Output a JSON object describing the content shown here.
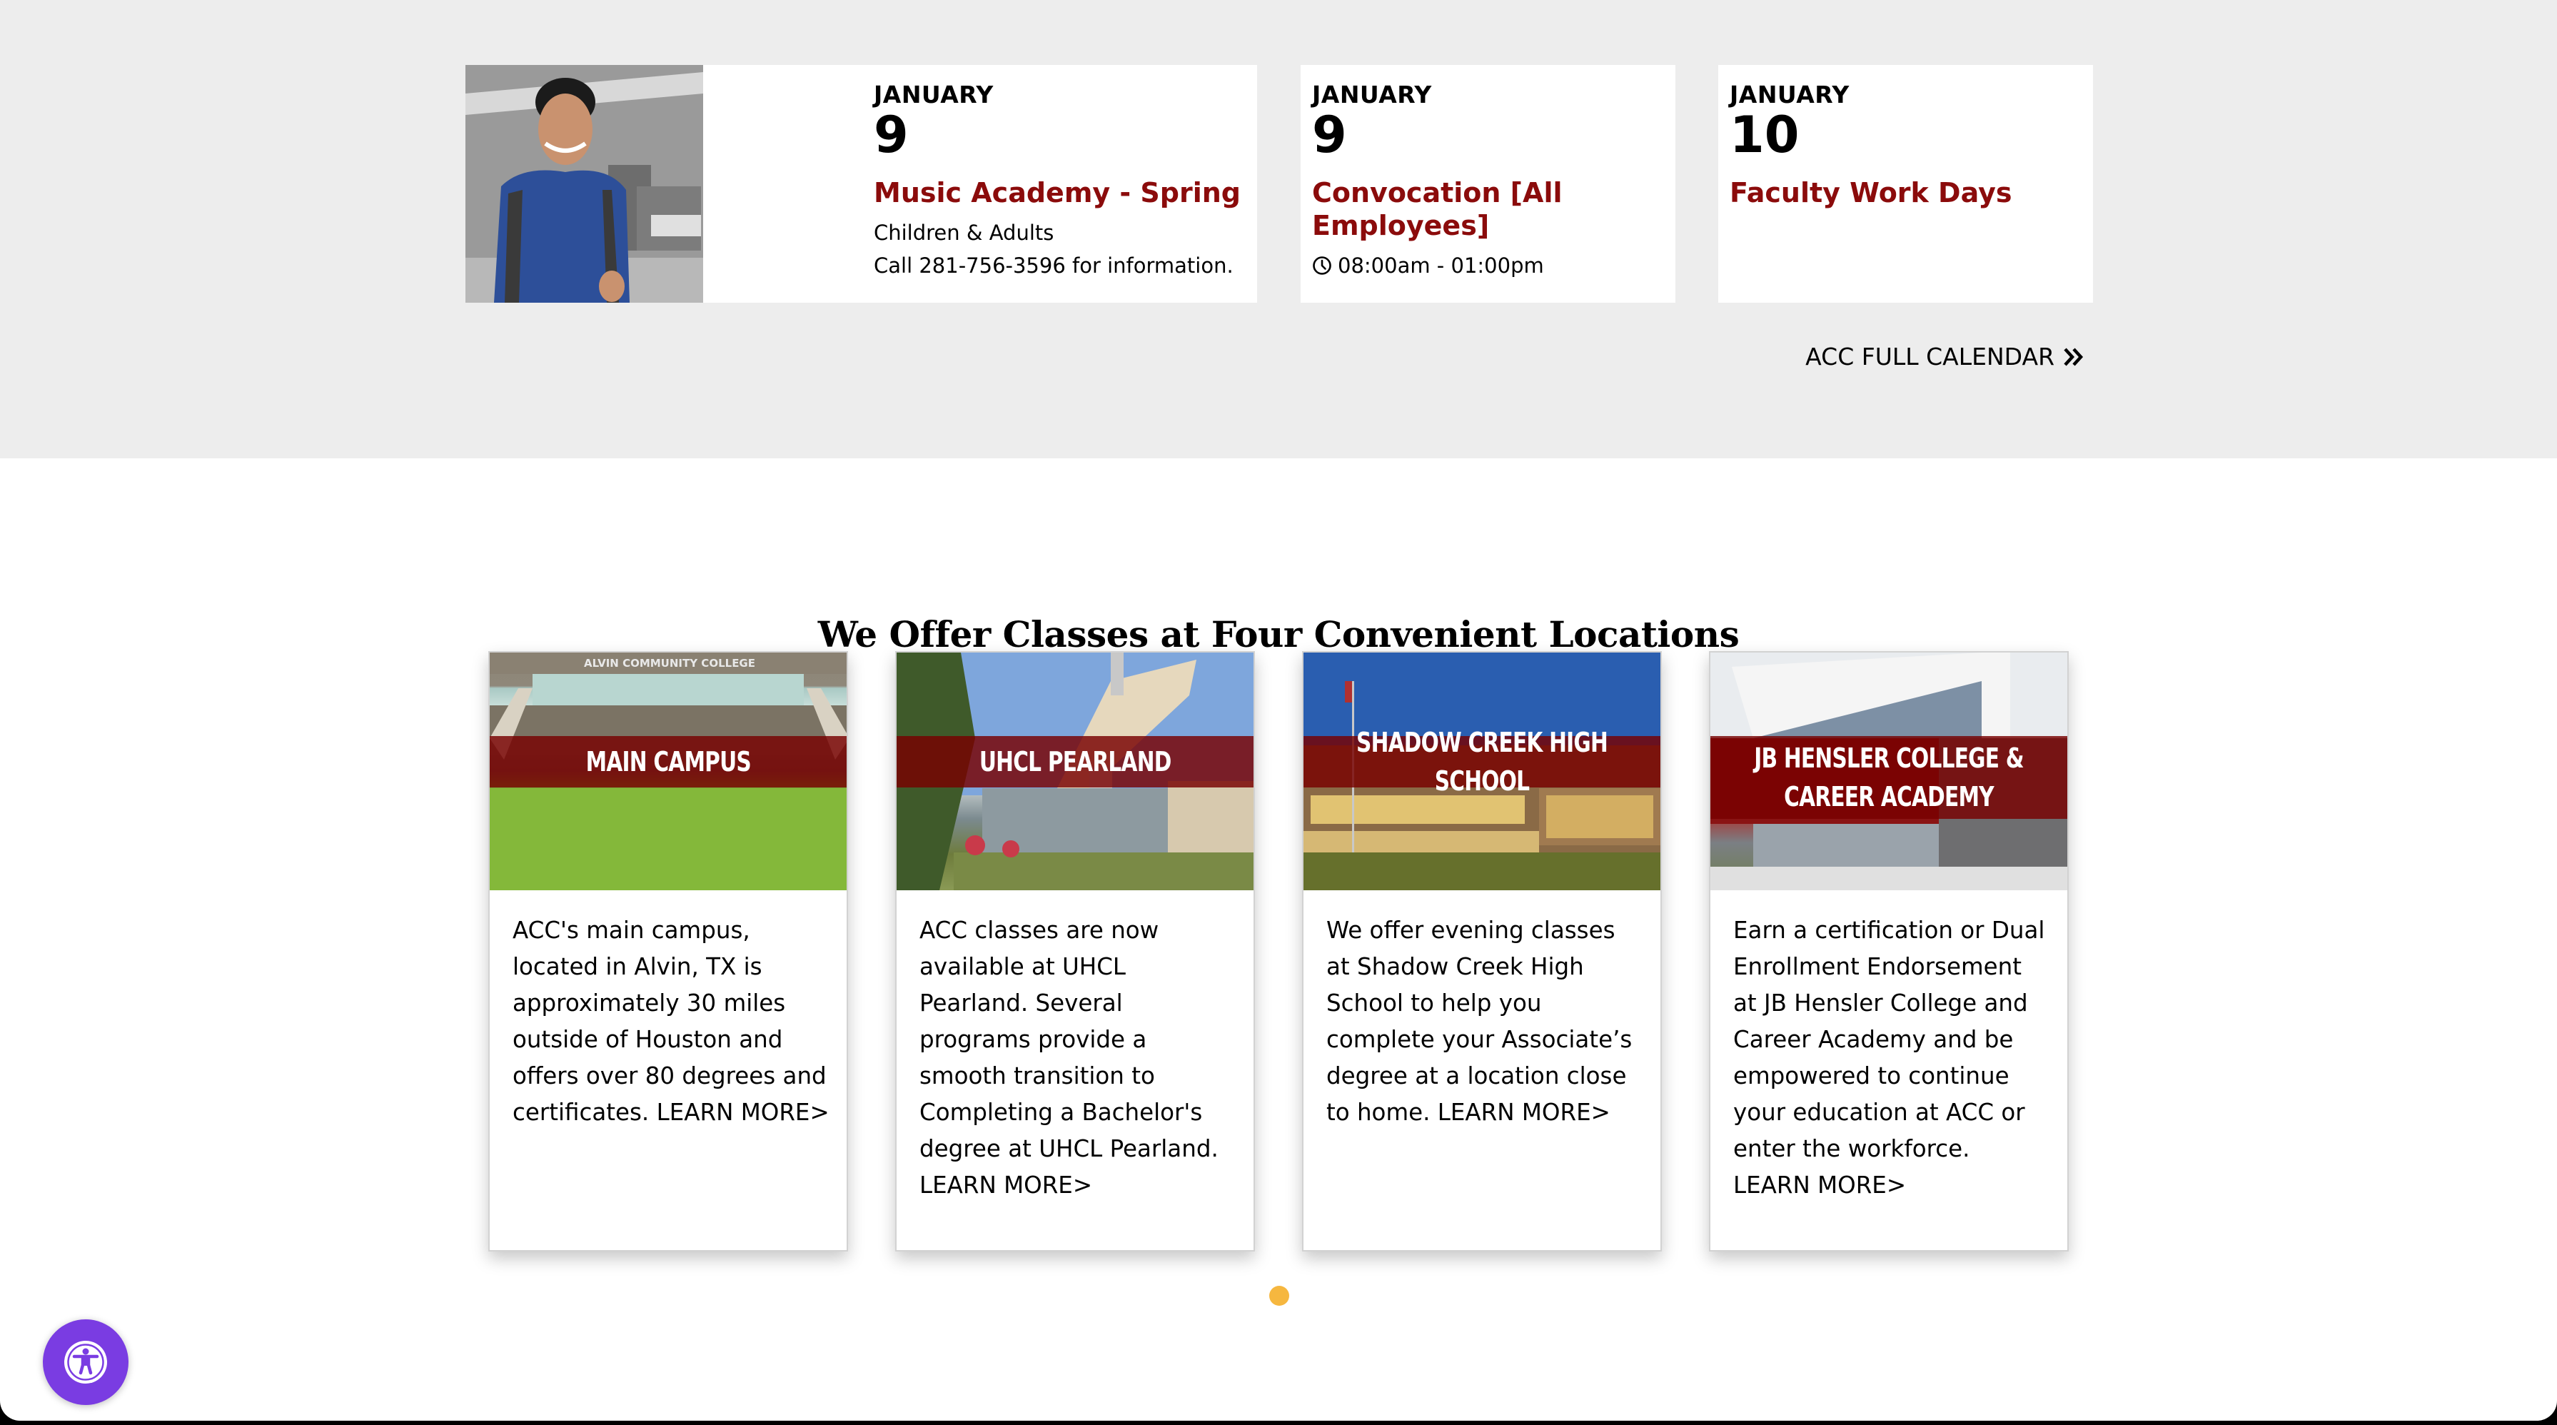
{
  "events": [
    {
      "month": "JANUARY",
      "day": "9",
      "title": "Music Academy - Spring",
      "description_lines": [
        "Children & Adults",
        "Call 281-756-3596 for information."
      ],
      "has_photo": true
    },
    {
      "month": "JANUARY",
      "day": "9",
      "title": "Convocation [All Employees]",
      "time": "08:00am - 01:00pm",
      "time_icon": "clock-icon"
    },
    {
      "month": "JANUARY",
      "day": "10",
      "title": "Faculty Work Days"
    }
  ],
  "full_calendar": {
    "label": "ACC FULL CALENDAR",
    "icon": "double-chevron-right-icon"
  },
  "locations": {
    "title": "We Offer Classes at Four Convenient Locations",
    "cards": [
      {
        "banner": "MAIN CAMPUS",
        "sign_text": "ALVIN  COMMUNITY  COLLEGE",
        "description": "ACC's main campus, located in Alvin, TX is approximately 30 miles outside of Houston and offers over 80 degrees and certificates.",
        "link": "LEARN MORE>"
      },
      {
        "banner": "UHCL PEARLAND",
        "description": "ACC classes are now available at UHCL Pearland. Several programs provide a smooth transition to Completing a Bachelor's degree at UHCL Pearland.",
        "link": "LEARN MORE>"
      },
      {
        "banner": "SHADOW CREEK HIGH SCHOOL",
        "description": "We offer evening classes at Shadow Creek High School to help you complete your Associate’s degree at a location close to home.",
        "link": "LEARN MORE>"
      },
      {
        "banner": "JB HENSLER COLLEGE &\nCAREER ACADEMY",
        "description": "Earn a certification or Dual Enrollment Endorsement at JB Hensler College and Career Academy and be empowered to continue your education at ACC or enter the workforce.",
        "link": "LEARN MORE>"
      }
    ]
  },
  "carousel": {
    "total_pages": 1,
    "active_page": 1,
    "active_color": "#f6b73f"
  },
  "accessibility": {
    "icon": "accessibility-icon",
    "color": "#7a3ce2"
  },
  "colors": {
    "band_background": "#ededed",
    "event_title": "#8b0b0b",
    "location_banner": "#780000"
  }
}
